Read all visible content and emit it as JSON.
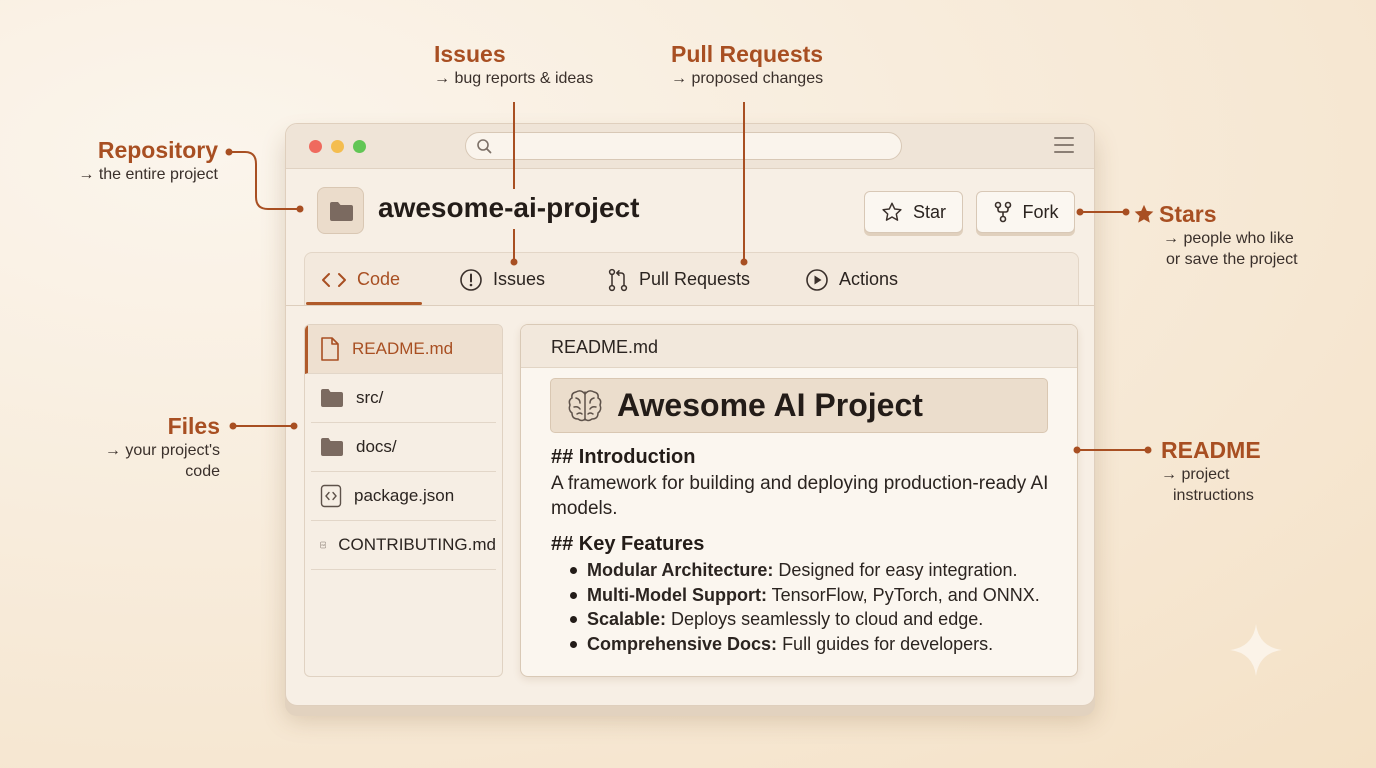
{
  "annotations": {
    "issues": {
      "title": "Issues",
      "desc": "→ bug reports & ideas"
    },
    "pull_requests": {
      "title": "Pull Requests",
      "desc": "→ proposed changes"
    },
    "repository": {
      "title": "Repository",
      "desc": "→ the entire project"
    },
    "files": {
      "title": "Files",
      "desc_line1": "→ your project's",
      "desc_line2": "code"
    },
    "stars": {
      "title": "Stars",
      "desc_line1": "→ people who like",
      "desc_line2": "or save the project"
    },
    "readme": {
      "title": "README",
      "desc_line1": "→ project",
      "desc_line2": "instructions"
    }
  },
  "repo": {
    "name": "awesome-ai-project",
    "star_label": "Star",
    "fork_label": "Fork"
  },
  "tabs": [
    {
      "label": "Code",
      "icon": "code-icon",
      "active": true
    },
    {
      "label": "Issues",
      "icon": "issue-icon",
      "active": false
    },
    {
      "label": "Pull Requests",
      "icon": "pull-request-icon",
      "active": false
    },
    {
      "label": "Actions",
      "icon": "play-icon",
      "active": false
    }
  ],
  "files": [
    {
      "name": "README.md",
      "icon": "file-icon",
      "active": true
    },
    {
      "name": "src/",
      "icon": "folder-icon",
      "active": false
    },
    {
      "name": "docs/",
      "icon": "folder-icon",
      "active": false
    },
    {
      "name": "package.json",
      "icon": "code-file-icon",
      "active": false
    },
    {
      "name": "CONTRIBUTING.md",
      "icon": "markdown-file-icon",
      "active": false
    }
  ],
  "readme": {
    "filename": "README.md",
    "title": "Awesome AI Project",
    "intro_heading": "## Introduction",
    "intro_text": "A framework for building and deploying production-ready AI models.",
    "features_heading": "## Key Features",
    "features": [
      {
        "label": "Modular Architecture:",
        "text": " Designed for easy integration."
      },
      {
        "label": "Multi-Model Support:",
        "text": " TensorFlow, PyTorch, and ONNX."
      },
      {
        "label": "Scalable:",
        "text": " Deploys seamlessly to cloud and edge."
      },
      {
        "label": "Comprehensive Docs:",
        "text": " Full guides for developers."
      }
    ]
  },
  "colors": {
    "accent": "#a84f22",
    "background": "#f7ead8",
    "window": "#f7efe5"
  }
}
